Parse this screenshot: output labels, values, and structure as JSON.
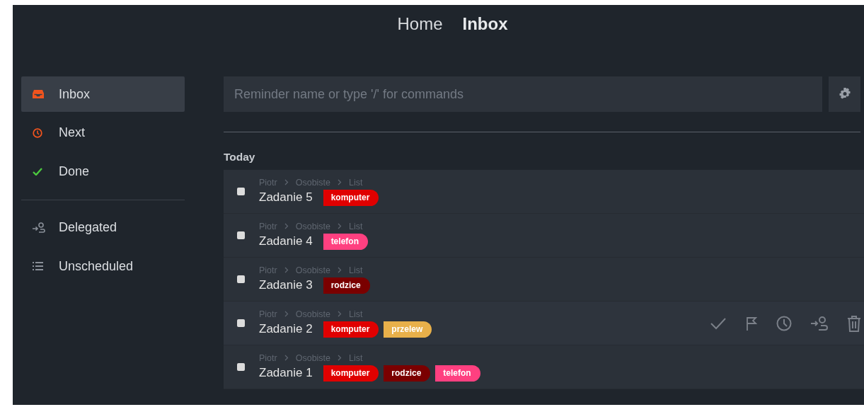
{
  "header_nav": [
    {
      "label": "Home",
      "selected": false
    },
    {
      "label": "Inbox",
      "selected": true
    }
  ],
  "sidebar": {
    "items": [
      {
        "kind": "inbox",
        "label": "Inbox",
        "selected": true
      },
      {
        "kind": "next",
        "label": "Next",
        "selected": false
      },
      {
        "kind": "done",
        "label": "Done",
        "selected": false
      },
      {
        "kind": "divider"
      },
      {
        "kind": "delegated",
        "label": "Delegated",
        "selected": false
      },
      {
        "kind": "unscheduled",
        "label": "Unscheduled",
        "selected": false
      }
    ]
  },
  "search": {
    "placeholder": "Reminder name or type '/' for commands"
  },
  "section": {
    "title": "Today"
  },
  "tasks": [
    {
      "breadcrumb": [
        "Piotr",
        "Osobiste",
        "List"
      ],
      "title": "Zadanie 5",
      "checked": false,
      "hovered": false,
      "tags": [
        {
          "label": "komputer",
          "color": "#e00000"
        }
      ]
    },
    {
      "breadcrumb": [
        "Piotr",
        "Osobiste",
        "List"
      ],
      "title": "Zadanie 4",
      "checked": false,
      "hovered": false,
      "tags": [
        {
          "label": "telefon",
          "color": "#ff4080"
        }
      ]
    },
    {
      "breadcrumb": [
        "Piotr",
        "Osobiste",
        "List"
      ],
      "title": "Zadanie 3",
      "checked": false,
      "hovered": false,
      "tags": [
        {
          "label": "rodzice",
          "color": "#7a0000"
        }
      ]
    },
    {
      "breadcrumb": [
        "Piotr",
        "Osobiste",
        "List"
      ],
      "title": "Zadanie 2",
      "checked": false,
      "hovered": true,
      "tags": [
        {
          "label": "komputer",
          "color": "#e00000"
        },
        {
          "label": "przelew",
          "color": "#e8b04a"
        }
      ]
    },
    {
      "breadcrumb": [
        "Piotr",
        "Osobiste",
        "List"
      ],
      "title": "Zadanie 1",
      "checked": false,
      "hovered": false,
      "tags": [
        {
          "label": "komputer",
          "color": "#e00000"
        },
        {
          "label": "rodzice",
          "color": "#7a0000"
        },
        {
          "label": "telefon",
          "color": "#ff4080"
        }
      ]
    }
  ]
}
